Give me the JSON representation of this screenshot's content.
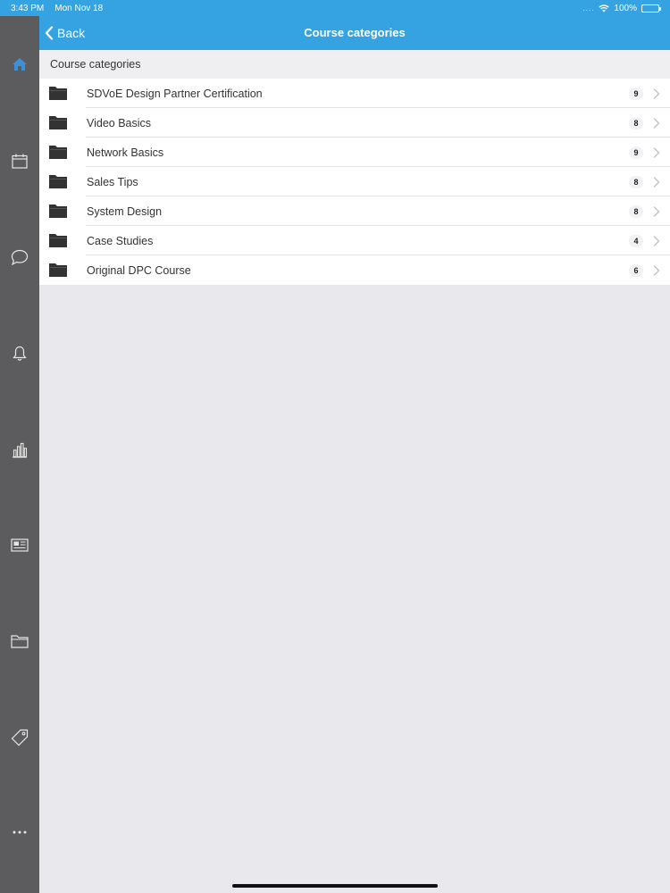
{
  "status": {
    "time": "3:43 PM",
    "date": "Mon Nov 18",
    "battery": "100%",
    "battery_level": 1.0
  },
  "nav": {
    "back_label": "Back",
    "title": "Course categories"
  },
  "sidebar": {
    "active": "home-icon",
    "items": [
      "home-icon",
      "calendar-icon",
      "chat-icon",
      "bell-icon",
      "chart-icon",
      "news-icon",
      "folder-icon",
      "tag-icon",
      "more-icon"
    ]
  },
  "section": {
    "header": "Course categories"
  },
  "categories": [
    {
      "name": "SDVoE Design Partner Certification",
      "count": "9"
    },
    {
      "name": "Video Basics",
      "count": "8"
    },
    {
      "name": "Network Basics",
      "count": "9"
    },
    {
      "name": "Sales Tips",
      "count": "8"
    },
    {
      "name": "System Design",
      "count": "8"
    },
    {
      "name": "Case Studies",
      "count": "4"
    },
    {
      "name": "Original DPC Course",
      "count": "6"
    }
  ],
  "colors": {
    "accent": "#35a2e2",
    "sidebar": "#5c5c5e",
    "background": "#e9e8ec",
    "active_icon": "#3d8fd6"
  }
}
